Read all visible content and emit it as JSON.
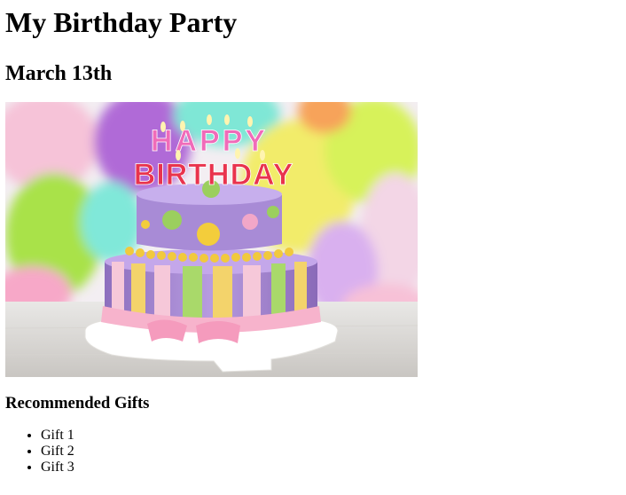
{
  "page": {
    "title": "My Birthday Party",
    "date": "March 13th"
  },
  "image": {
    "alt": "Birthday cake with Happy Birthday candles in front of colorful balloons",
    "candle_text_top": "HAPPY",
    "candle_text_bottom": "BIRTHDAY"
  },
  "gifts": {
    "heading": "Recommended Gifts",
    "items": [
      "Gift 1",
      "Gift 2",
      "Gift 3"
    ]
  }
}
